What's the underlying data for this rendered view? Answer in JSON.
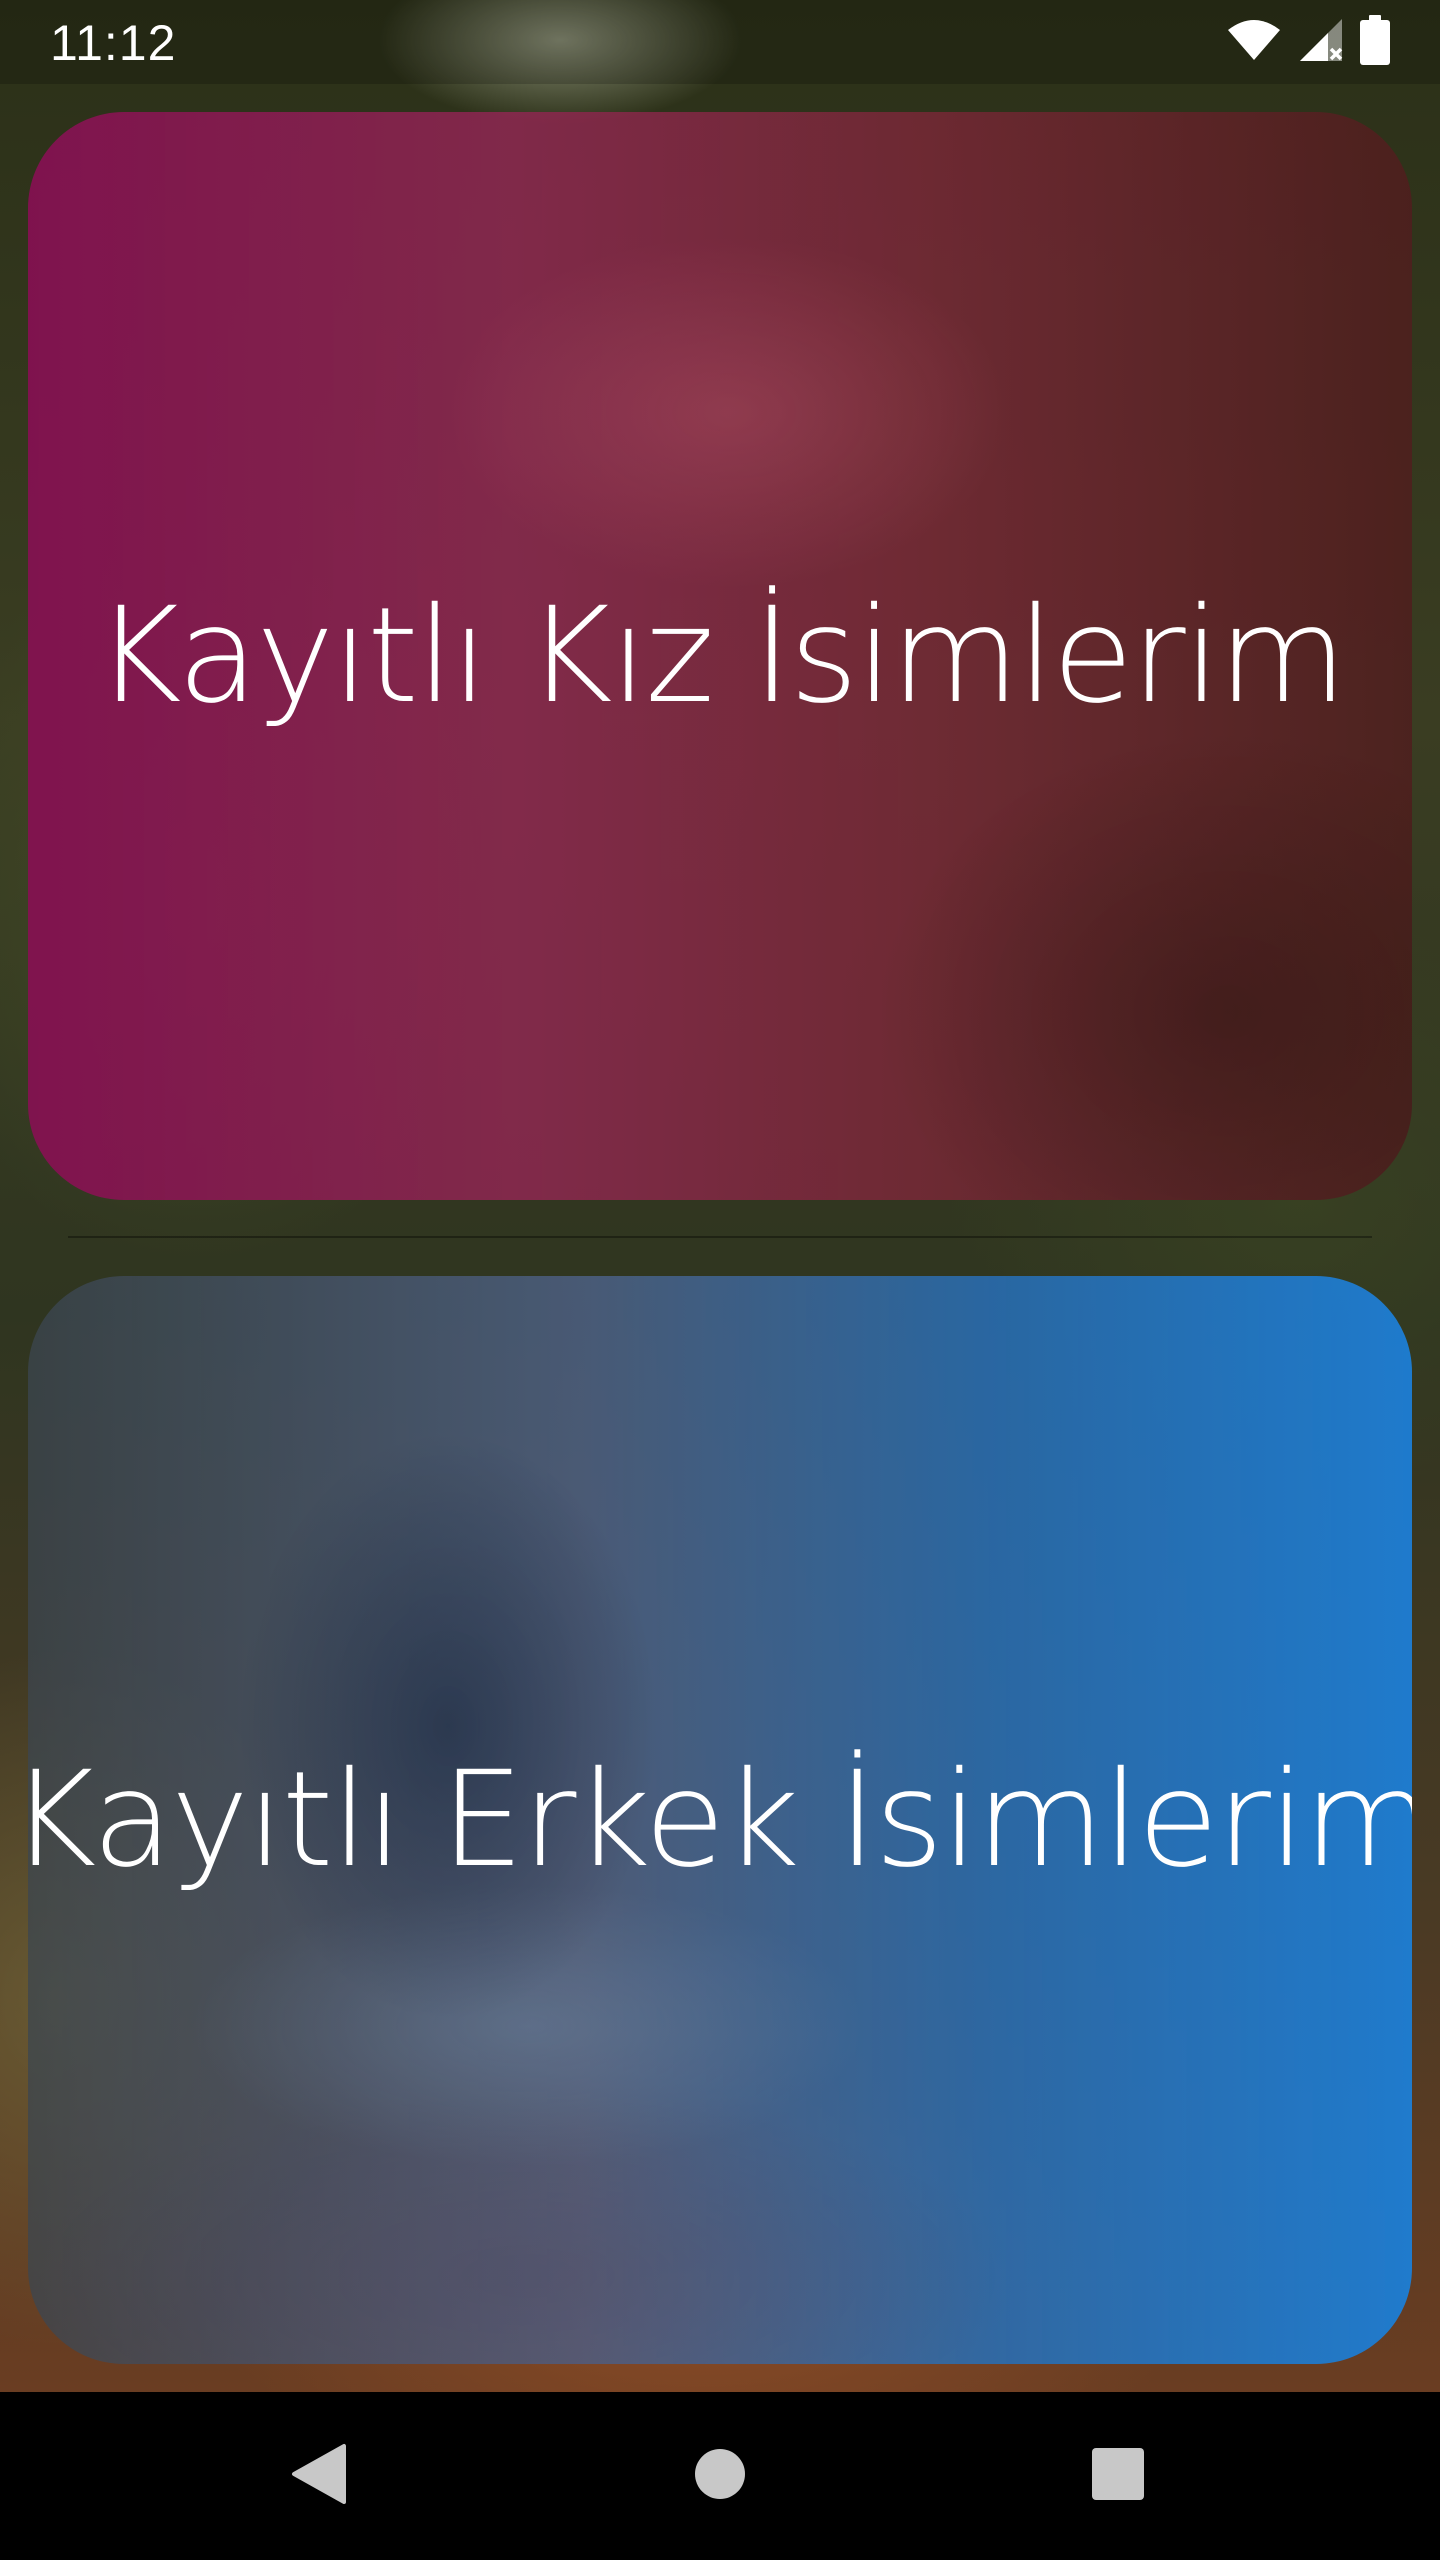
{
  "status_bar": {
    "time": "11:12",
    "icons": [
      "wifi-icon",
      "cell-signal-no-service-icon",
      "battery-full-icon"
    ]
  },
  "cards": [
    {
      "label": "Kayıtlı Kız İsimlerim",
      "accent": "#8A1A55"
    },
    {
      "label": "Kayıtlı Erkek İsimlerim",
      "accent": "#1E7BD0"
    }
  ],
  "nav_bar": {
    "icons": [
      "back-icon",
      "home-icon",
      "recents-icon"
    ]
  }
}
